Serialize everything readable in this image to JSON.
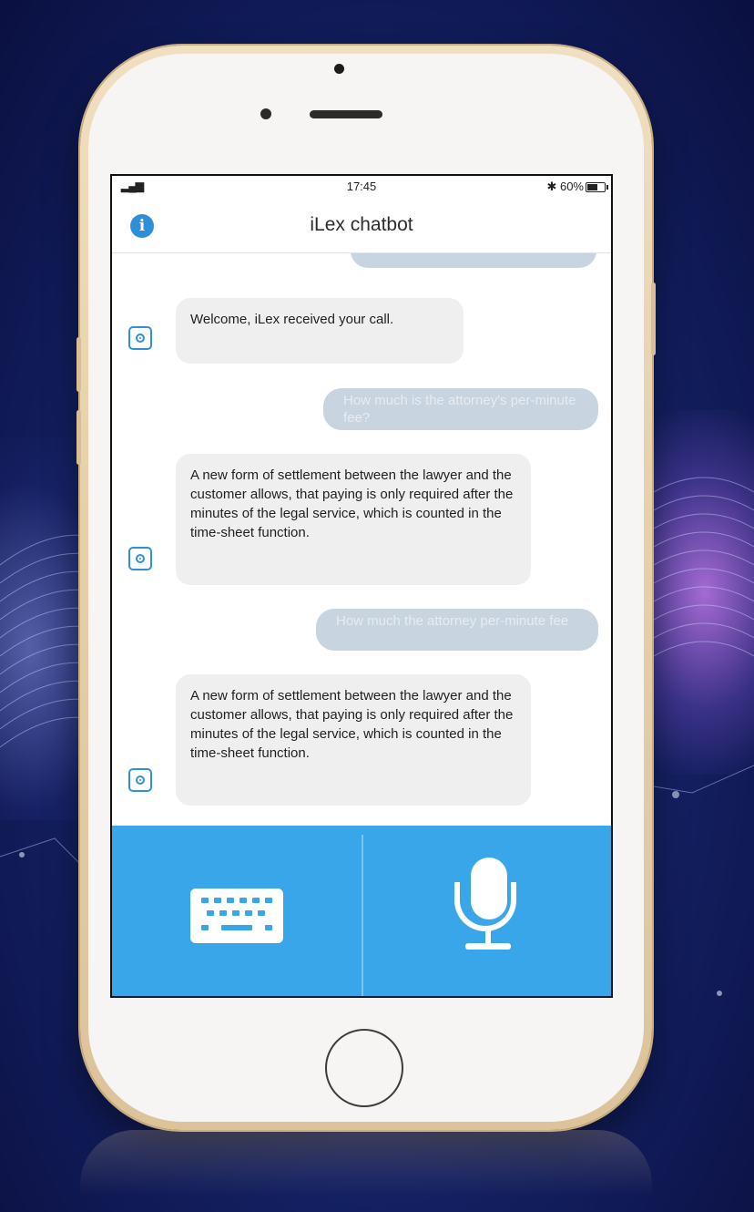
{
  "status_bar": {
    "time": "17:45",
    "battery": "✱ 60%",
    "battery_level": 0.6
  },
  "header": {
    "title": "iLex chatbot",
    "info_icon": "i"
  },
  "messages": [
    {
      "sender": "user",
      "text": ""
    },
    {
      "sender": "bot",
      "text": "Welcome, iLex received your call."
    },
    {
      "sender": "user",
      "text": "How much is the attorney's per-minute fee?"
    },
    {
      "sender": "bot",
      "text": "A new form of settlement between the lawyer and the customer allows, that paying is only required after the minutes of the legal service, which is counted in the time-sheet function."
    },
    {
      "sender": "user",
      "text": "How much the attorney per-minute fee"
    },
    {
      "sender": "bot",
      "text": "A new form of settlement between the lawyer and the customer allows, that paying is only required after the minutes of the legal service, which is counted in the time-sheet function."
    }
  ],
  "input_panel": {
    "left_icon": "keyboard-icon",
    "right_icon": "microphone-icon"
  },
  "colors": {
    "accent": "#3aa6ea",
    "bot_bubble": "#efefef",
    "user_bubble": "#c8d4df",
    "phone_frame": "#e7d1ab"
  }
}
